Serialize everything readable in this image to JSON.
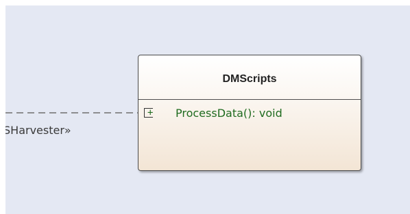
{
  "diagram": {
    "class": {
      "name": "DMScripts",
      "operations": [
        {
          "visibility": "+",
          "signature": "ProcessData(): void"
        }
      ]
    },
    "connector": {
      "stereotype": "«RSHarvester»",
      "visible_label": "SHarvester»",
      "style": "dashed"
    }
  },
  "colors": {
    "canvas_background": "#e4e8f3",
    "class_border": "#4d4d4d",
    "class_fill_top": "#ffffff",
    "class_fill_bottom": "#f3e5d5",
    "operation_text": "#1f6b1f",
    "connector_line": "#6e6e6e"
  }
}
